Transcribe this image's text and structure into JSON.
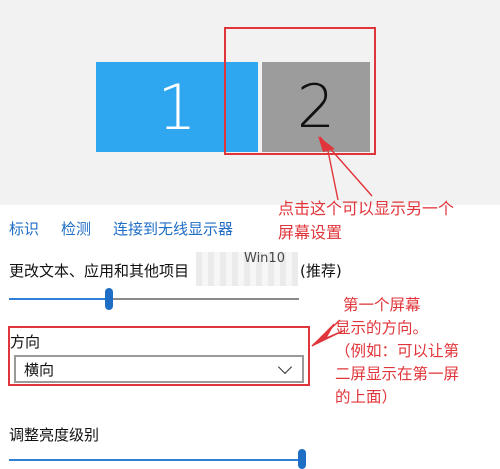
{
  "display": {
    "monitors": [
      {
        "number": "1",
        "color": "#2ea6f0"
      },
      {
        "number": "2",
        "color": "#9c9c9c"
      }
    ]
  },
  "links": {
    "identify": "标识",
    "detect": "检测",
    "connect_wireless": "连接到无线显示器"
  },
  "scale": {
    "label": "更改文本、应用和其他项目",
    "tag": "(推荐)",
    "watermark_text": "Win10",
    "slider_level": 0.4
  },
  "orientation": {
    "label": "方向",
    "value": "横向"
  },
  "brightness": {
    "label": "调整亮度级别",
    "slider_level": 1.0
  },
  "annotations": {
    "callout_1_line1": "点击这个可以显示另一个",
    "callout_1_line2": "屏幕设置",
    "callout_2_line1": "第一个屏幕",
    "callout_2_line2": "显示的方向。",
    "callout_2_line3": "（例如：可以让第",
    "callout_2_line4": "二屏显示在第一屏",
    "callout_2_line5": "的上面）"
  },
  "colors": {
    "accent": "#1f6ec5",
    "annotation_red": "#e0353a"
  }
}
